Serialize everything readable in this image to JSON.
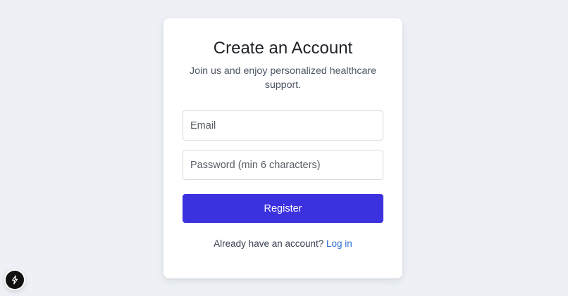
{
  "card": {
    "title": "Create an Account",
    "subtitle": "Join us and enjoy personalized healthcare support."
  },
  "form": {
    "email": {
      "placeholder": "Email",
      "value": ""
    },
    "password": {
      "placeholder": "Password (min 6 characters)",
      "value": ""
    },
    "register_label": "Register"
  },
  "footer": {
    "prompt": "Already have an account?",
    "link_label": "Log in"
  },
  "dev_badge": {
    "icon": "lightning-bolt-icon"
  },
  "colors": {
    "background": "#edf1f5",
    "card": "#ffffff",
    "primary_button": "#3b31df",
    "link": "#2c6fd1",
    "text": "#1f2328"
  }
}
